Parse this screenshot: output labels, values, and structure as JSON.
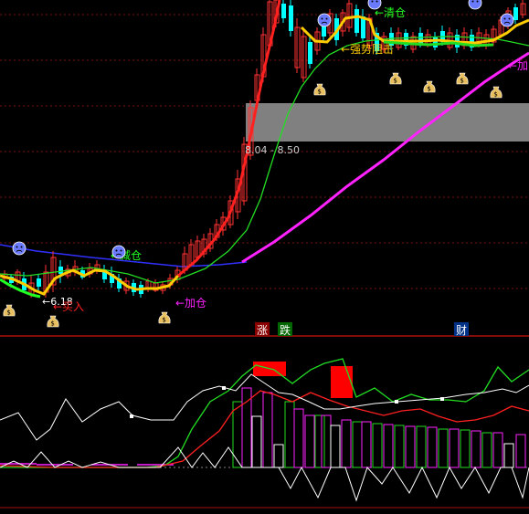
{
  "chart_data": [
    {
      "type": "candlestick",
      "panel": "price",
      "annotations": {
        "clear_position": "←清仓",
        "strong_resistance": "←强势阻击",
        "add_position_top": "←加",
        "reduce_position": "←减仓",
        "price_low": "←6.18",
        "buy": "←买入",
        "add_position": "←加仓",
        "price_range": "8.04 - 8.50"
      },
      "icons": [
        "sad-face-icon",
        "money-bag-icon"
      ],
      "colors": {
        "up_candle": "#ff3232",
        "down_candle": "#00ffff",
        "ma_red": "#ff2020",
        "ma_green": "#22dd22",
        "ma_magenta": "#ff22ff",
        "ma_blue": "#3030ff",
        "ma_yellow": "#ffcc00",
        "band_gray": "#808080"
      }
    },
    {
      "type": "mixed",
      "panel": "indicator",
      "markers": {
        "rise": "涨",
        "fall": "跌",
        "finance": "财"
      }
    }
  ]
}
